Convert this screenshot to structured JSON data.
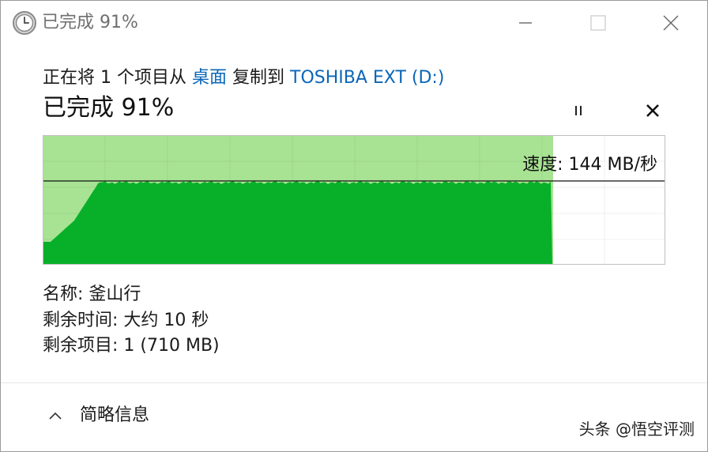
{
  "window": {
    "title": "已完成 91%"
  },
  "description": {
    "prefix": "正在将 1 个项目从 ",
    "source": "桌面",
    "middle": " 复制到 ",
    "destination": "TOSHIBA EXT (D:)"
  },
  "status": {
    "percent_text": "已完成 91%",
    "progress": 0.91
  },
  "graph": {
    "speed_text": "速度: 144 MB/秒",
    "current_speed_mb_s": 144
  },
  "details": {
    "name_label": "名称:",
    "name_value": "釜山行",
    "time_label": "剩余时间:",
    "time_value": "大约 10 秒",
    "items_label": "剩余项目:",
    "items_value": "1 (710 MB)"
  },
  "footer": {
    "toggle_label": "简略信息",
    "watermark": "头条 @悟空评测"
  },
  "colors": {
    "progress_fill": "#a8e393",
    "speed_fill": "#08b02a",
    "link": "#0a66b8"
  },
  "icons": {
    "title": "clock-icon",
    "minimize": "minimize-icon",
    "maximize": "maximize-icon",
    "close": "close-icon",
    "pause": "pause-icon",
    "cancel": "cancel-icon",
    "toggle": "chevron-up-icon"
  }
}
